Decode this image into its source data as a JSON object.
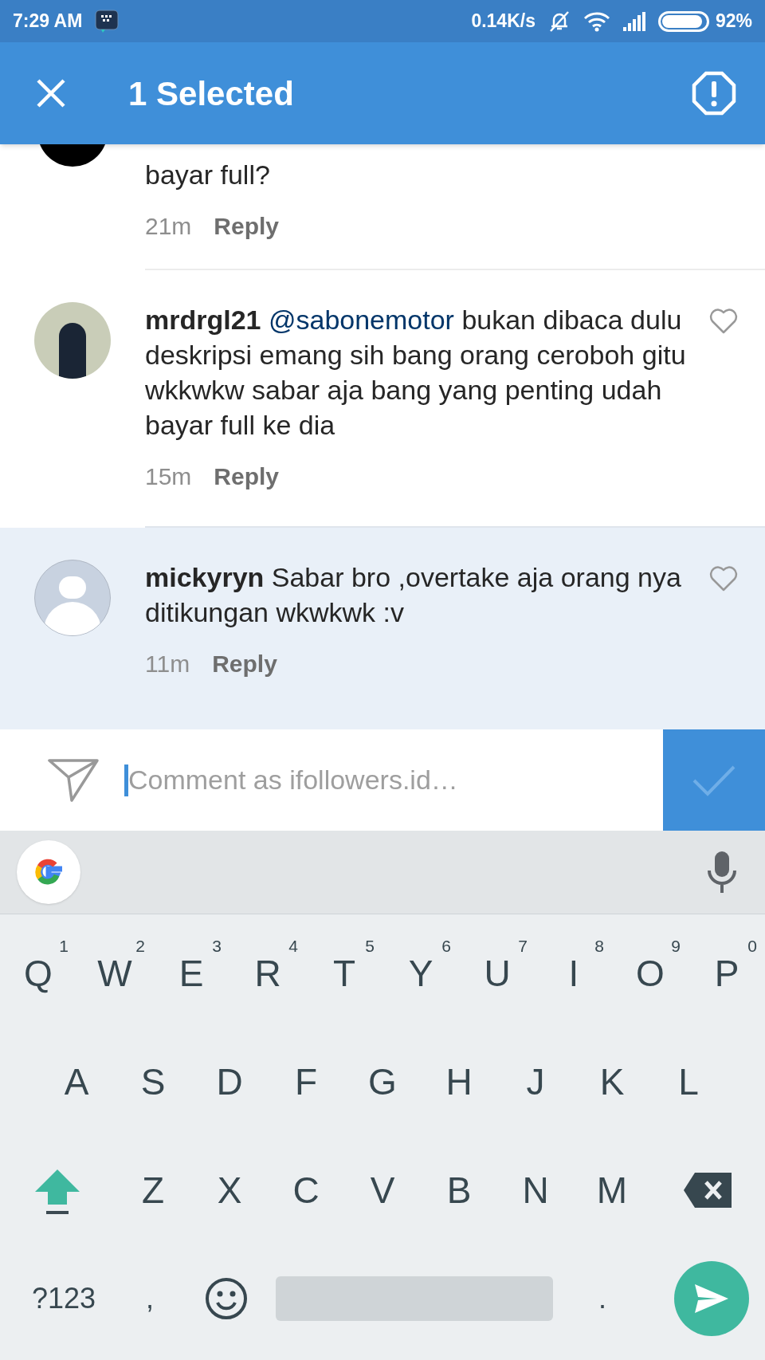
{
  "status_bar": {
    "time": "7:29 AM",
    "speed": "0.14K/s",
    "battery": "92%"
  },
  "app_bar": {
    "title": "1 Selected"
  },
  "comments": [
    {
      "kind": "cut_off",
      "text": "bayar full?",
      "time": "21m",
      "reply": "Reply",
      "selected": false
    },
    {
      "username": "mrdrgl21",
      "mention": "@sabonemotor",
      "text": " bukan dibaca dulu deskripsi emang sih bang orang ceroboh gitu wkkwkw sabar aja bang yang penting udah bayar full ke dia",
      "time": "15m",
      "reply": "Reply",
      "liked": false,
      "kind": "photo_avatar",
      "selected": false
    },
    {
      "username": "mickyryn",
      "text": "Sabar bro ,overtake aja orang nya ditikungan wkwkwk :v",
      "time": "11m",
      "reply": "Reply",
      "liked": false,
      "kind": "default_avatar",
      "selected": true
    }
  ],
  "comment_input": {
    "placeholder": "Comment as ifollowers.id…"
  },
  "keyboard": {
    "rows": [
      [
        {
          "label": "Q",
          "hint": "1"
        },
        {
          "label": "W",
          "hint": "2"
        },
        {
          "label": "E",
          "hint": "3"
        },
        {
          "label": "R",
          "hint": "4"
        },
        {
          "label": "T",
          "hint": "5"
        },
        {
          "label": "Y",
          "hint": "6"
        },
        {
          "label": "U",
          "hint": "7"
        },
        {
          "label": "I",
          "hint": "8"
        },
        {
          "label": "O",
          "hint": "9"
        },
        {
          "label": "P",
          "hint": "0"
        }
      ],
      [
        {
          "label": "A"
        },
        {
          "label": "S"
        },
        {
          "label": "D"
        },
        {
          "label": "F"
        },
        {
          "label": "G"
        },
        {
          "label": "H"
        },
        {
          "label": "J"
        },
        {
          "label": "K"
        },
        {
          "label": "L"
        }
      ],
      [
        {
          "label": "Z"
        },
        {
          "label": "X"
        },
        {
          "label": "C"
        },
        {
          "label": "V"
        },
        {
          "label": "B"
        },
        {
          "label": "N"
        },
        {
          "label": "M"
        }
      ]
    ],
    "bottom_row": [
      {
        "kind": "text",
        "label": "?123"
      },
      {
        "kind": "text",
        "label": ","
      },
      {
        "kind": "emoji"
      },
      {
        "kind": "space"
      },
      {
        "kind": "text",
        "label": "."
      },
      {
        "kind": "send"
      }
    ]
  }
}
